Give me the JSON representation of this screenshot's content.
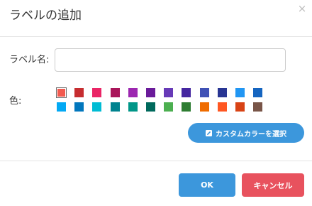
{
  "dialog": {
    "title": "ラベルの追加",
    "close_glyph": "×"
  },
  "form": {
    "name_label": "ラベル名:",
    "name_value": "",
    "name_placeholder": "",
    "color_label": "色:"
  },
  "colors": {
    "selected_index": 0,
    "palette": [
      "#f25a4f",
      "#c62d30",
      "#ea2566",
      "#a9155a",
      "#9c27b0",
      "#6a1b9a",
      "#673ab7",
      "#4527a0",
      "#3f51b5",
      "#283593",
      "#2196f3",
      "#1565c0",
      "#03a9f4",
      "#0277bd",
      "#00bcd4",
      "#00838f",
      "#009688",
      "#00695c",
      "#4caf50",
      "#2e7d32",
      "#ef6c00",
      "#ff5722",
      "#d84315",
      "#795548"
    ]
  },
  "custom_color": {
    "label": "カスタムカラーを選択",
    "icon": "edit-square-icon"
  },
  "footer": {
    "ok_label": "OK",
    "cancel_label": "キャンセル"
  },
  "theme": {
    "primary": "#3c97dc",
    "danger": "#e8525e"
  }
}
